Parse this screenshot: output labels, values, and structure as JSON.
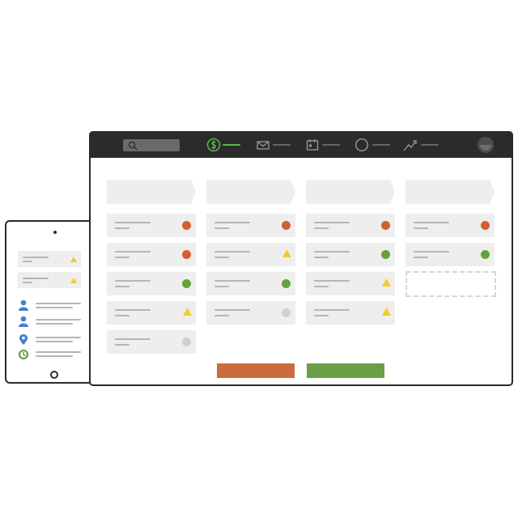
{
  "colors": {
    "frame": "#2a2a2a",
    "toolbar": "#2b2b2b",
    "card": "#eeeeee",
    "status_red": "#d45f2e",
    "status_green": "#64a33c",
    "status_yellow": "#f2cc2c",
    "status_gray": "#cfcfcf",
    "button_red": "#cd6a3e",
    "button_green": "#6b9e47",
    "accent": "#5db848"
  },
  "toolbar": {
    "items": [
      {
        "icon": "dollar-icon",
        "active": true
      },
      {
        "icon": "mail-icon",
        "active": false
      },
      {
        "icon": "calendar-icon",
        "active": false
      },
      {
        "icon": "circle-icon",
        "active": false
      },
      {
        "icon": "trend-icon",
        "active": false
      }
    ],
    "search_icon": "search-icon",
    "avatar_icon": "avatar-icon"
  },
  "board": {
    "columns": [
      {
        "cards": [
          {
            "status": "red"
          },
          {
            "status": "red"
          },
          {
            "status": "green"
          },
          {
            "status": "yellow"
          },
          {
            "status": "gray"
          }
        ]
      },
      {
        "cards": [
          {
            "status": "red"
          },
          {
            "status": "yellow"
          },
          {
            "status": "green"
          },
          {
            "status": "gray"
          }
        ]
      },
      {
        "cards": [
          {
            "status": "red"
          },
          {
            "status": "green"
          },
          {
            "status": "yellow"
          },
          {
            "status": "yellow"
          }
        ]
      },
      {
        "cards": [
          {
            "status": "red"
          },
          {
            "status": "green"
          }
        ],
        "has_dropzone": true
      }
    ]
  },
  "tablet": {
    "cards": [
      {
        "status": "yellow"
      },
      {
        "status": "yellow"
      }
    ],
    "list": [
      {
        "icon": "user-icon"
      },
      {
        "icon": "user-icon"
      },
      {
        "icon": "location-pin-icon"
      },
      {
        "icon": "clock-icon"
      }
    ]
  }
}
